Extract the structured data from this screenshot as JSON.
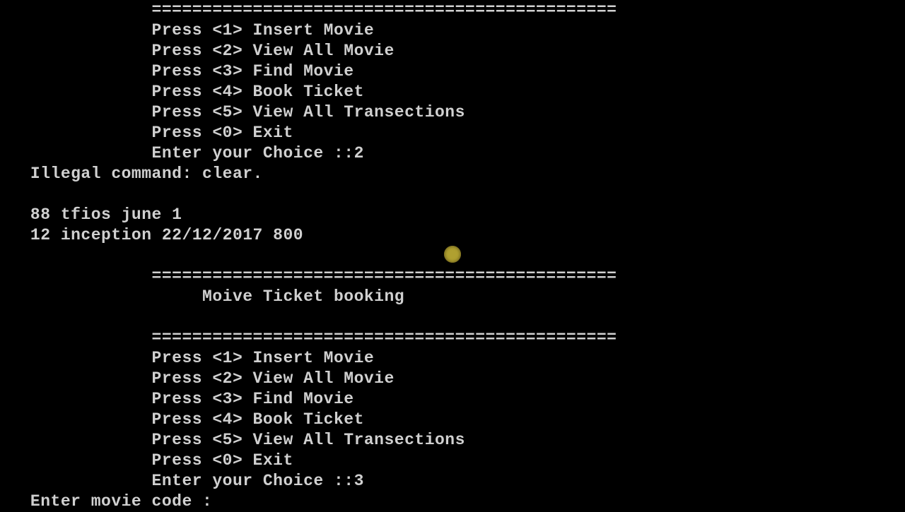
{
  "divider": "               ==============================================",
  "menu": {
    "opt1": "               Press <1> Insert Movie",
    "opt2": "               Press <2> View All Movie",
    "opt3": "               Press <3> Find Movie",
    "opt4": "               Press <4> Book Ticket",
    "opt5": "               Press <5> View All Transections",
    "opt0": "               Press <0> Exit"
  },
  "prompt1": "               Enter your Choice ::2",
  "error": "   Illegal command: clear.",
  "blank": "",
  "row1": "   88 tfios june 1",
  "row2": "   12 inception 22/12/2017 800",
  "title": "                    Moive Ticket booking",
  "prompt2": "               Enter your Choice ::3",
  "prompt3": "   Enter movie code :"
}
